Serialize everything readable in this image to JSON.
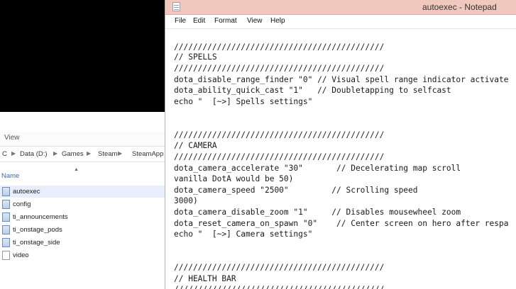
{
  "explorer": {
    "view_label": "View",
    "breadcrumb": [
      "C",
      "Data (D:)",
      "Games",
      "Steam",
      "SteamApp"
    ],
    "column_name": "Name",
    "files": [
      {
        "name": "autoexec",
        "icon": "config-file-icon",
        "selected": true
      },
      {
        "name": "config",
        "icon": "config-file-icon"
      },
      {
        "name": "ti_announcements",
        "icon": "config-file-icon"
      },
      {
        "name": "ti_onstage_pods",
        "icon": "config-file-icon"
      },
      {
        "name": "ti_onstage_side",
        "icon": "config-file-icon"
      },
      {
        "name": "video",
        "icon": "blank-file-icon"
      }
    ]
  },
  "notepad": {
    "title": "autoexec - Notepad",
    "menu": [
      "File",
      "Edit",
      "Format",
      "View",
      "Help"
    ],
    "lines": [
      "////////////////////////////////////////////",
      "// SPELLS",
      "////////////////////////////////////////////",
      "dota_disable_range_finder \"0\" // Visual spell range indicator activate",
      "dota_ability_quick_cast \"1\"   // Doubletapping to selfcast",
      "echo \"  [~>] Spells settings\"",
      "",
      "",
      "////////////////////////////////////////////",
      "// CAMERA",
      "////////////////////////////////////////////",
      "dota_camera_accelerate \"30\"       // Decelerating map scroll",
      "vanilla DotA would be 50)",
      "dota_camera_speed \"2500\"         // Scrolling speed",
      "3000)",
      "dota_camera_disable_zoom \"1\"     // Disables mousewheel zoom",
      "dota_reset_camera_on_spawn \"0\"    // Center screen on hero after respa",
      "echo \"  [~>] Camera settings\"",
      "",
      "",
      "////////////////////////////////////////////",
      "// HEALTH BAR",
      "////////////////////////////////////////////"
    ]
  }
}
